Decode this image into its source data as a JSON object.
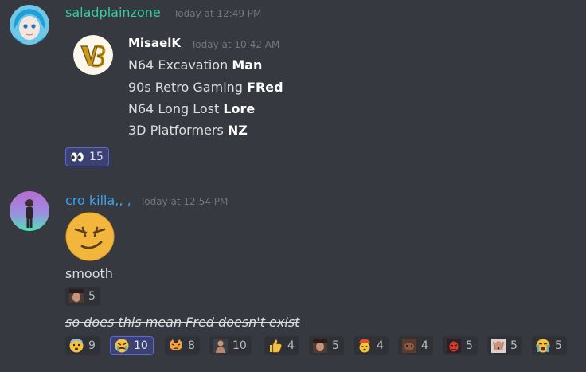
{
  "message1": {
    "username": "saladplainzone",
    "username_color": "#2ed0a3",
    "timestamp": "Today at 12:49 PM",
    "embed": {
      "author": "MisaelK",
      "timestamp": "Today at 10:42 AM",
      "lines": [
        {
          "prefix": "N64 Excavation ",
          "bold": "Man"
        },
        {
          "prefix": "90s Retro Gaming ",
          "bold": "FRed"
        },
        {
          "prefix": "N64 Long Lost ",
          "bold": "Lore"
        },
        {
          "prefix": "3D Platformers ",
          "bold": "NZ"
        }
      ]
    },
    "reactions": [
      {
        "icon": "eyes-emoji-icon",
        "count": "15",
        "active": true
      }
    ]
  },
  "message2": {
    "username": "cro killa,, ,",
    "username_color": "#3ba4f0",
    "timestamp": "Today at 12:54 PM",
    "big_emoji": "smirk-face-emoji-icon",
    "text": "smooth",
    "reactions_smooth": [
      {
        "icon": "face-photo-emoji-icon",
        "count": "5",
        "active": false
      }
    ],
    "text2": "so does this mean Fred doesn't exist",
    "reactions": [
      {
        "icon": "fearful-face-emoji-icon",
        "count": "9",
        "active": false
      },
      {
        "icon": "crying-angry-emoji-icon",
        "count": "10",
        "active": true
      },
      {
        "icon": "pouting-cat-emoji-icon",
        "count": "8",
        "active": false
      },
      {
        "icon": "person-photo-emoji-icon",
        "count": "10",
        "active": false
      },
      {
        "icon": "thumbs-up-emoji-icon",
        "count": "4",
        "active": false
      },
      {
        "icon": "face-photo-emoji-icon",
        "count": "5",
        "active": false
      },
      {
        "icon": "exploding-head-emoji-icon",
        "count": "4",
        "active": false
      },
      {
        "icon": "dog-photo-emoji-icon",
        "count": "4",
        "active": false
      },
      {
        "icon": "red-face-emoji-icon",
        "count": "5",
        "active": false
      },
      {
        "icon": "screaming-photo-emoji-icon",
        "count": "5",
        "active": false
      },
      {
        "icon": "loudly-crying-emoji-icon",
        "count": "5",
        "active": false
      }
    ]
  }
}
